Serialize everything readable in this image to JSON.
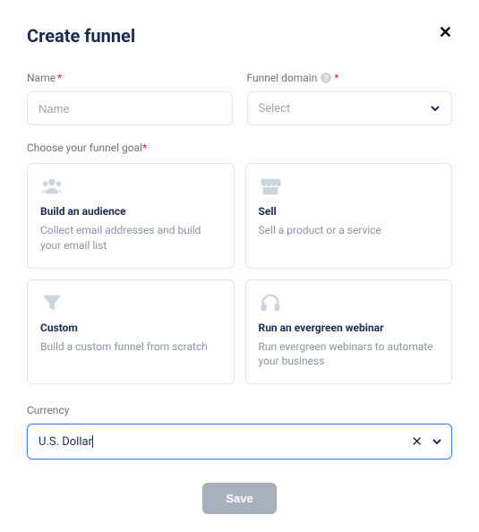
{
  "title": "Create funnel",
  "name_field": {
    "label": "Name",
    "placeholder": "Name"
  },
  "domain_field": {
    "label": "Funnel domain",
    "placeholder": "Select"
  },
  "goal_label": "Choose your funnel goal",
  "goals": [
    {
      "title": "Build an audience",
      "desc": "Collect email addresses and build your email list"
    },
    {
      "title": "Sell",
      "desc": "Sell a product or a service"
    },
    {
      "title": "Custom",
      "desc": "Build a custom funnel from scratch"
    },
    {
      "title": "Run an evergreen webinar",
      "desc": "Run evergreen webinars to automate your business"
    }
  ],
  "currency": {
    "label": "Currency",
    "value": "U.S. Dollar"
  },
  "save_label": "Save",
  "required_mark": "*",
  "info_glyph": "?"
}
